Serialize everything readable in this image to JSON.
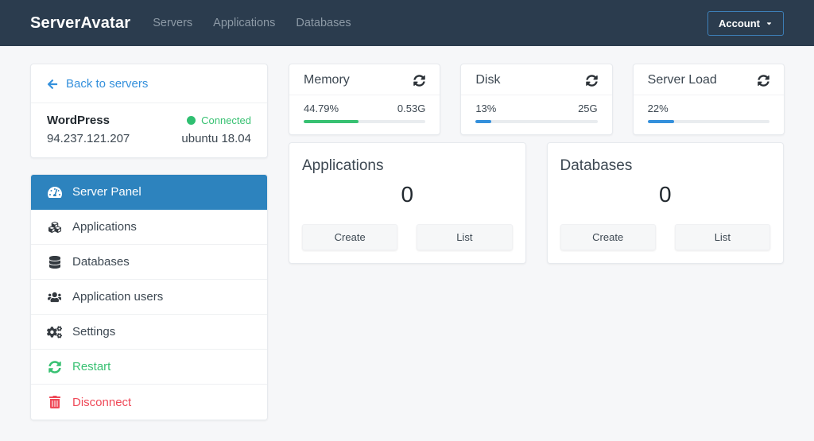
{
  "colors": {
    "navbar_bg": "#2b3c4e",
    "active_item_bg": "#2d83be",
    "link_blue": "#3490dc",
    "success_green": "#38c172",
    "danger_red": "#ef4958",
    "page_bg": "#f6f7f9"
  },
  "navbar": {
    "brand": "ServerAvatar",
    "links": [
      "Servers",
      "Applications",
      "Databases"
    ],
    "account_label": "Account"
  },
  "sidebar": {
    "back_link": "Back to servers",
    "server": {
      "name": "WordPress",
      "status": "Connected",
      "ip": "94.237.121.207",
      "os": "ubuntu 18.04"
    },
    "menu": [
      {
        "label": "Server Panel",
        "icon": "tachometer-icon",
        "active": true
      },
      {
        "label": "Applications",
        "icon": "cubes-icon"
      },
      {
        "label": "Databases",
        "icon": "database-icon"
      },
      {
        "label": "Application users",
        "icon": "users-icon"
      },
      {
        "label": "Settings",
        "icon": "cogs-icon"
      },
      {
        "label": "Restart",
        "icon": "sync-icon",
        "variant": "success"
      },
      {
        "label": "Disconnect",
        "icon": "trash-icon",
        "variant": "danger"
      }
    ]
  },
  "stats": [
    {
      "title": "Memory",
      "percent_label": "44.79%",
      "percent": 44.79,
      "value": "0.53G",
      "bar_color": "#38c172"
    },
    {
      "title": "Disk",
      "percent_label": "13%",
      "percent": 13,
      "value": "25G",
      "bar_color": "#3490dc"
    },
    {
      "title": "Server Load",
      "percent_label": "22%",
      "percent": 22,
      "value": "",
      "bar_color": "#3490dc"
    }
  ],
  "panels": [
    {
      "title": "Applications",
      "count": "0",
      "buttons": [
        "Create",
        "List"
      ]
    },
    {
      "title": "Databases",
      "count": "0",
      "buttons": [
        "Create",
        "List"
      ]
    }
  ]
}
